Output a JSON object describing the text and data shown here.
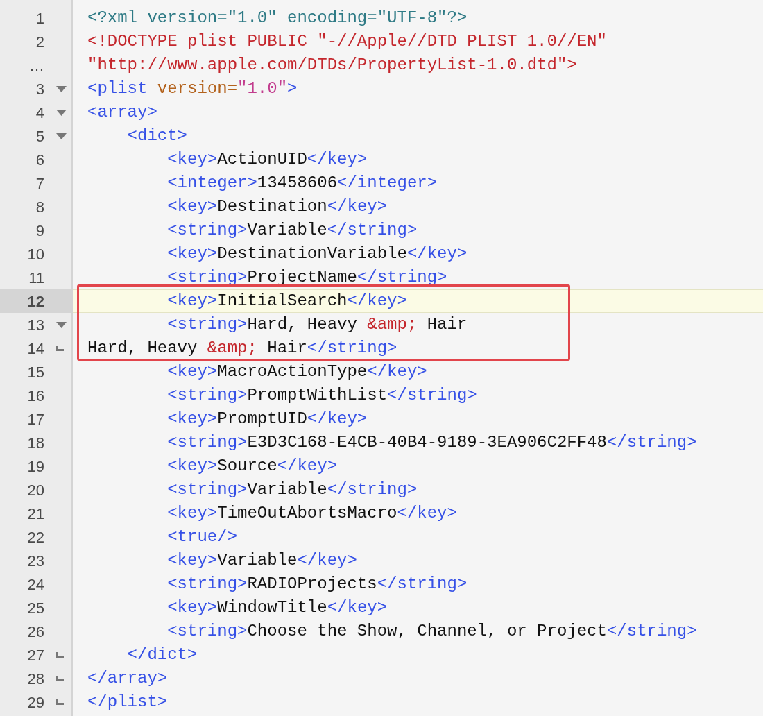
{
  "editor": {
    "lines": [
      {
        "number": "1",
        "fold_start": false,
        "fold_end": false,
        "selected": false,
        "boxed": false,
        "tokens": [
          {
            "kind": "decl",
            "text": "<?xml version=\"1.0\" encoding=\"UTF-8\"?>"
          }
        ]
      },
      {
        "number": "2",
        "fold_start": false,
        "fold_end": false,
        "selected": false,
        "boxed": false,
        "tokens": [
          {
            "kind": "doctype",
            "text": "<!DOCTYPE plist PUBLIC \"-//Apple//DTD PLIST 1.0//EN\""
          }
        ]
      },
      {
        "number": "…",
        "fold_start": false,
        "fold_end": false,
        "selected": false,
        "boxed": false,
        "tokens": [
          {
            "kind": "doctype",
            "text": "\"http://www.apple.com/DTDs/PropertyList-1.0.dtd\">"
          }
        ]
      },
      {
        "number": "3",
        "fold_start": true,
        "fold_end": false,
        "selected": false,
        "boxed": false,
        "tokens": [
          {
            "kind": "tag",
            "text": "<plist"
          },
          {
            "kind": "attr",
            "text": " version="
          },
          {
            "kind": "value",
            "text": "\"1.0\""
          },
          {
            "kind": "tag",
            "text": ">"
          }
        ]
      },
      {
        "number": "4",
        "fold_start": true,
        "fold_end": false,
        "selected": false,
        "boxed": false,
        "tokens": [
          {
            "kind": "tag",
            "text": "<array>"
          }
        ]
      },
      {
        "number": "5",
        "fold_start": true,
        "fold_end": false,
        "selected": false,
        "boxed": false,
        "tokens": [
          {
            "kind": "tag",
            "text": "\t<dict>"
          }
        ]
      },
      {
        "number": "6",
        "fold_start": false,
        "fold_end": false,
        "selected": false,
        "boxed": false,
        "tokens": [
          {
            "kind": "tag",
            "text": "\t\t<key>"
          },
          {
            "kind": "text",
            "text": "ActionUID"
          },
          {
            "kind": "tag",
            "text": "</key>"
          }
        ]
      },
      {
        "number": "7",
        "fold_start": false,
        "fold_end": false,
        "selected": false,
        "boxed": false,
        "tokens": [
          {
            "kind": "tag",
            "text": "\t\t<integer>"
          },
          {
            "kind": "text",
            "text": "13458606"
          },
          {
            "kind": "tag",
            "text": "</integer>"
          }
        ]
      },
      {
        "number": "8",
        "fold_start": false,
        "fold_end": false,
        "selected": false,
        "boxed": false,
        "tokens": [
          {
            "kind": "tag",
            "text": "\t\t<key>"
          },
          {
            "kind": "text",
            "text": "Destination"
          },
          {
            "kind": "tag",
            "text": "</key>"
          }
        ]
      },
      {
        "number": "9",
        "fold_start": false,
        "fold_end": false,
        "selected": false,
        "boxed": false,
        "tokens": [
          {
            "kind": "tag",
            "text": "\t\t<string>"
          },
          {
            "kind": "text",
            "text": "Variable"
          },
          {
            "kind": "tag",
            "text": "</string>"
          }
        ]
      },
      {
        "number": "10",
        "fold_start": false,
        "fold_end": false,
        "selected": false,
        "boxed": false,
        "tokens": [
          {
            "kind": "tag",
            "text": "\t\t<key>"
          },
          {
            "kind": "text",
            "text": "DestinationVariable"
          },
          {
            "kind": "tag",
            "text": "</key>"
          }
        ]
      },
      {
        "number": "11",
        "fold_start": false,
        "fold_end": false,
        "selected": false,
        "boxed": false,
        "tokens": [
          {
            "kind": "tag",
            "text": "\t\t<string>"
          },
          {
            "kind": "text",
            "text": "ProjectName"
          },
          {
            "kind": "tag",
            "text": "</string>"
          }
        ]
      },
      {
        "number": "12",
        "fold_start": false,
        "fold_end": false,
        "selected": true,
        "boxed": true,
        "tokens": [
          {
            "kind": "tag",
            "text": "\t\t<key>"
          },
          {
            "kind": "text",
            "text": "InitialSearch"
          },
          {
            "kind": "tag",
            "text": "</key>"
          }
        ]
      },
      {
        "number": "13",
        "fold_start": true,
        "fold_end": false,
        "selected": false,
        "boxed": true,
        "tokens": [
          {
            "kind": "tag",
            "text": "\t\t<string>"
          },
          {
            "kind": "text",
            "text": "Hard, Heavy "
          },
          {
            "kind": "entity",
            "text": "&amp;"
          },
          {
            "kind": "text",
            "text": " Hair"
          }
        ]
      },
      {
        "number": "14",
        "fold_start": false,
        "fold_end": true,
        "selected": false,
        "boxed": true,
        "tokens": [
          {
            "kind": "text",
            "text": "Hard, Heavy "
          },
          {
            "kind": "entity",
            "text": "&amp;"
          },
          {
            "kind": "text",
            "text": " Hair"
          },
          {
            "kind": "tag",
            "text": "</string>"
          }
        ]
      },
      {
        "number": "15",
        "fold_start": false,
        "fold_end": false,
        "selected": false,
        "boxed": false,
        "tokens": [
          {
            "kind": "tag",
            "text": "\t\t<key>"
          },
          {
            "kind": "text",
            "text": "MacroActionType"
          },
          {
            "kind": "tag",
            "text": "</key>"
          }
        ]
      },
      {
        "number": "16",
        "fold_start": false,
        "fold_end": false,
        "selected": false,
        "boxed": false,
        "tokens": [
          {
            "kind": "tag",
            "text": "\t\t<string>"
          },
          {
            "kind": "text",
            "text": "PromptWithList"
          },
          {
            "kind": "tag",
            "text": "</string>"
          }
        ]
      },
      {
        "number": "17",
        "fold_start": false,
        "fold_end": false,
        "selected": false,
        "boxed": false,
        "tokens": [
          {
            "kind": "tag",
            "text": "\t\t<key>"
          },
          {
            "kind": "text",
            "text": "PromptUID"
          },
          {
            "kind": "tag",
            "text": "</key>"
          }
        ]
      },
      {
        "number": "18",
        "fold_start": false,
        "fold_end": false,
        "selected": false,
        "boxed": false,
        "tokens": [
          {
            "kind": "tag",
            "text": "\t\t<string>"
          },
          {
            "kind": "text",
            "text": "E3D3C168-E4CB-40B4-9189-3EA906C2FF48"
          },
          {
            "kind": "tag",
            "text": "</string>"
          }
        ]
      },
      {
        "number": "19",
        "fold_start": false,
        "fold_end": false,
        "selected": false,
        "boxed": false,
        "tokens": [
          {
            "kind": "tag",
            "text": "\t\t<key>"
          },
          {
            "kind": "text",
            "text": "Source"
          },
          {
            "kind": "tag",
            "text": "</key>"
          }
        ]
      },
      {
        "number": "20",
        "fold_start": false,
        "fold_end": false,
        "selected": false,
        "boxed": false,
        "tokens": [
          {
            "kind": "tag",
            "text": "\t\t<string>"
          },
          {
            "kind": "text",
            "text": "Variable"
          },
          {
            "kind": "tag",
            "text": "</string>"
          }
        ]
      },
      {
        "number": "21",
        "fold_start": false,
        "fold_end": false,
        "selected": false,
        "boxed": false,
        "tokens": [
          {
            "kind": "tag",
            "text": "\t\t<key>"
          },
          {
            "kind": "text",
            "text": "TimeOutAbortsMacro"
          },
          {
            "kind": "tag",
            "text": "</key>"
          }
        ]
      },
      {
        "number": "22",
        "fold_start": false,
        "fold_end": false,
        "selected": false,
        "boxed": false,
        "tokens": [
          {
            "kind": "tag",
            "text": "\t\t<true/>"
          }
        ]
      },
      {
        "number": "23",
        "fold_start": false,
        "fold_end": false,
        "selected": false,
        "boxed": false,
        "tokens": [
          {
            "kind": "tag",
            "text": "\t\t<key>"
          },
          {
            "kind": "text",
            "text": "Variable"
          },
          {
            "kind": "tag",
            "text": "</key>"
          }
        ]
      },
      {
        "number": "24",
        "fold_start": false,
        "fold_end": false,
        "selected": false,
        "boxed": false,
        "tokens": [
          {
            "kind": "tag",
            "text": "\t\t<string>"
          },
          {
            "kind": "text",
            "text": "RADIOProjects"
          },
          {
            "kind": "tag",
            "text": "</string>"
          }
        ]
      },
      {
        "number": "25",
        "fold_start": false,
        "fold_end": false,
        "selected": false,
        "boxed": false,
        "tokens": [
          {
            "kind": "tag",
            "text": "\t\t<key>"
          },
          {
            "kind": "text",
            "text": "WindowTitle"
          },
          {
            "kind": "tag",
            "text": "</key>"
          }
        ]
      },
      {
        "number": "26",
        "fold_start": false,
        "fold_end": false,
        "selected": false,
        "boxed": false,
        "tokens": [
          {
            "kind": "tag",
            "text": "\t\t<string>"
          },
          {
            "kind": "text",
            "text": "Choose the Show, Channel, or Project"
          },
          {
            "kind": "tag",
            "text": "</string>"
          }
        ]
      },
      {
        "number": "27",
        "fold_start": false,
        "fold_end": true,
        "selected": false,
        "boxed": false,
        "tokens": [
          {
            "kind": "tag",
            "text": "\t</dict>"
          }
        ]
      },
      {
        "number": "28",
        "fold_start": false,
        "fold_end": true,
        "selected": false,
        "boxed": false,
        "tokens": [
          {
            "kind": "tag",
            "text": "</array>"
          }
        ]
      },
      {
        "number": "29",
        "fold_start": false,
        "fold_end": true,
        "selected": false,
        "boxed": false,
        "tokens": [
          {
            "kind": "tag",
            "text": "</plist>"
          }
        ]
      }
    ]
  }
}
